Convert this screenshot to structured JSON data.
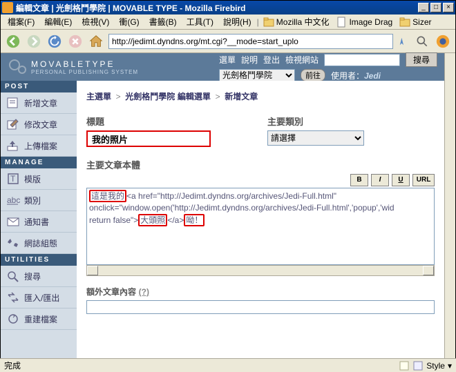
{
  "window": {
    "title": "編輯文章 | 光劍格鬥學院 | MOVABLE TYPE - Mozilla Firebird",
    "min": "_",
    "max": "□",
    "close": "×"
  },
  "menubar": {
    "file": "檔案(F)",
    "edit": "編輯(E)",
    "view": "檢視(V)",
    "go": "衝(G)",
    "bookmarks": "書籤(B)",
    "tools": "工具(T)",
    "help": "說明(H)",
    "bm1": "Mozilla 中文化",
    "bm2": "Image Drag",
    "bm3": "Sizer"
  },
  "toolbar": {
    "url": "http://jedimt.dyndns.org/mt.cgi?__mode=start_uplo"
  },
  "mt_logo": {
    "main": "MOVABLETYPE",
    "sub": "PERSONAL PUBLISHING SYSTEM"
  },
  "mt_nav": {
    "menu": "選單",
    "help": "說明",
    "logout": "登出",
    "viewsite": "檢視網站",
    "search_btn": "搜尋",
    "blog_selected": "光劍格鬥學院",
    "go_btn": "前往",
    "user_label": "使用者：",
    "user_name": "Jedi"
  },
  "sidebar": {
    "post_header": "POST",
    "manage_header": "MANAGE",
    "utilities_header": "UTILITIES",
    "items": [
      {
        "label": "新增文章"
      },
      {
        "label": "修改文章"
      },
      {
        "label": "上傳檔案"
      },
      {
        "label": "模版"
      },
      {
        "label": "類別"
      },
      {
        "label": "通知書"
      },
      {
        "label": "網誌組態"
      },
      {
        "label": "搜尋"
      },
      {
        "label": "匯入/匯出"
      },
      {
        "label": "重建檔案"
      }
    ]
  },
  "editor": {
    "bc_main": "主選單",
    "bc_blog": "光劍格鬥學院",
    "bc_edit": "編輯選單",
    "bc_new": "新增文章",
    "title_label": "標題",
    "cat_label": "主要類別",
    "title_value": "我的照片",
    "cat_value": "請選擇",
    "body_label": "主要文章本體",
    "fmt": {
      "b": "B",
      "i": "I",
      "u": "U",
      "url": "URL"
    },
    "body_hl1": "這是我的",
    "body_mid1": "<a href=\"http://Jedimt.dyndns.org/archives/Jedi-Full.html\" onclick=\"window.open('http://Jedimt.dyndns.org/archives/Jedi-Full.html','popup','wid",
    "body_mid2": "return false\">",
    "body_hl2": "大頭照",
    "body_mid3": "</a>",
    "body_hl3": "呦！",
    "extra_label": "額外文章內容",
    "extra_q": "(?)"
  },
  "statusbar": {
    "done": "完成",
    "style": "Style"
  }
}
